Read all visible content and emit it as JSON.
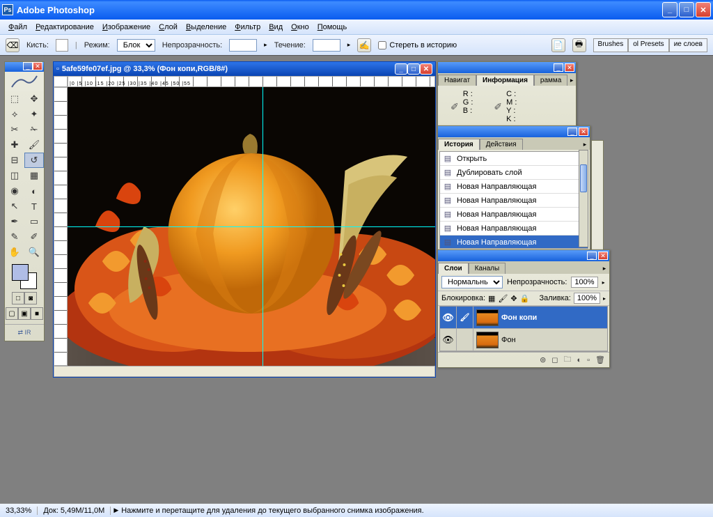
{
  "app_title": "Adobe Photoshop",
  "menus": [
    "Файл",
    "Редактирование",
    "Изображение",
    "Слой",
    "Выделение",
    "Фильтр",
    "Вид",
    "Окно",
    "Помощь"
  ],
  "options": {
    "brush_label": "Кисть:",
    "mode_label": "Режим:",
    "mode_value": "Блок",
    "opacity_label": "Непрозрачность:",
    "flow_label": "Течение:",
    "erase_history": "Стереть в историю",
    "tabs": [
      "Brushes",
      "ol Presets",
      "ие слоев"
    ]
  },
  "doc_title": "5afe59fe07ef.jpg @ 33,3% (Фон копи,RGB/8#)",
  "ruler_ticks": "|0      |5      |10      |15      |20      |25      |30      |35      |40      |45      |50      |55",
  "info": {
    "tabs": [
      "Навигат",
      "Информация",
      "рамма"
    ],
    "left_labels": [
      "R :",
      "G :",
      "B :"
    ],
    "right_labels": [
      "C :",
      "M :",
      "Y :",
      "K :"
    ]
  },
  "history": {
    "tabs": [
      "История",
      "Действия"
    ],
    "items": [
      "Открыть",
      "Дублировать слой",
      "Новая Направляющая",
      "Новая Направляющая",
      "Новая Направляющая",
      "Новая Направляющая",
      "Новая Направляющая"
    ]
  },
  "layers": {
    "tabs": [
      "Слои",
      "Каналы"
    ],
    "blend_mode": "Нормальный",
    "opacity_label": "Непрозрачность:",
    "opacity_value": "100%",
    "lock_label": "Блокировка:",
    "fill_label": "Заливка:",
    "fill_value": "100%",
    "items": [
      {
        "name": "Фон копи",
        "selected": true
      },
      {
        "name": "Фон",
        "selected": false
      }
    ]
  },
  "status": {
    "zoom": "33,33%",
    "docinfo": "Док: 5,49M/11,0M",
    "hint": "Нажмите и перетащите для удаления до текущего выбранного снимка изображения."
  }
}
